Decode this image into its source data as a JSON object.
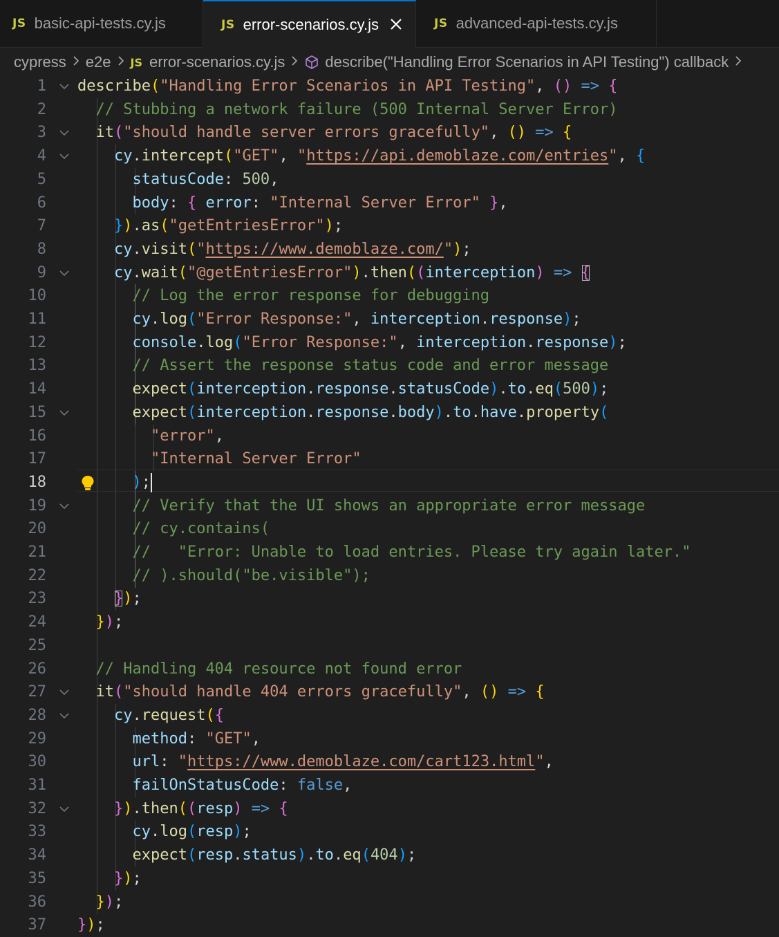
{
  "tabs": [
    {
      "label": "basic-api-tests.cy.js",
      "icon": "JS",
      "active": false
    },
    {
      "label": "error-scenarios.cy.js",
      "icon": "JS",
      "active": true
    },
    {
      "label": "advanced-api-tests.cy.js",
      "icon": "JS",
      "active": false
    }
  ],
  "breadcrumb": {
    "folder1": "cypress",
    "folder2": "e2e",
    "file_icon": "JS",
    "file": "error-scenarios.cy.js",
    "symbol": "describe(\"Handling Error Scenarios in API Testing\") callback"
  },
  "editor": {
    "active_line": 18,
    "lines": [
      {
        "n": "1"
      },
      {
        "n": "2"
      },
      {
        "n": "3"
      },
      {
        "n": "4"
      },
      {
        "n": "5"
      },
      {
        "n": "6"
      },
      {
        "n": "7"
      },
      {
        "n": "8"
      },
      {
        "n": "9"
      },
      {
        "n": "10"
      },
      {
        "n": "11"
      },
      {
        "n": "12"
      },
      {
        "n": "13"
      },
      {
        "n": "14"
      },
      {
        "n": "15"
      },
      {
        "n": "16"
      },
      {
        "n": "17"
      },
      {
        "n": "18"
      },
      {
        "n": "19"
      },
      {
        "n": "20"
      },
      {
        "n": "21"
      },
      {
        "n": "22"
      },
      {
        "n": "23"
      },
      {
        "n": "24"
      },
      {
        "n": "25"
      },
      {
        "n": "26"
      },
      {
        "n": "27"
      },
      {
        "n": "28"
      },
      {
        "n": "29"
      },
      {
        "n": "30"
      },
      {
        "n": "31"
      },
      {
        "n": "32"
      },
      {
        "n": "33"
      },
      {
        "n": "34"
      },
      {
        "n": "35"
      },
      {
        "n": "36"
      },
      {
        "n": "37"
      }
    ],
    "code": [
      [
        [
          "describe",
          "f"
        ],
        [
          "(",
          "b1"
        ],
        [
          "\"Handling Error Scenarios in API Testing\"",
          "s"
        ],
        [
          ", ",
          "p"
        ],
        [
          "()",
          "b2"
        ],
        [
          " => ",
          "k"
        ],
        [
          "{",
          "b2"
        ]
      ],
      [
        [
          "  ",
          "p"
        ],
        [
          "// Stubbing a network failure (500 Internal Server Error)",
          "c"
        ]
      ],
      [
        [
          "  ",
          "p"
        ],
        [
          "it",
          "f"
        ],
        [
          "(",
          "b2"
        ],
        [
          "\"should handle server errors gracefully\"",
          "s"
        ],
        [
          ", ",
          "p"
        ],
        [
          "()",
          "b1"
        ],
        [
          " => ",
          "k"
        ],
        [
          "{",
          "b1"
        ]
      ],
      [
        [
          "    ",
          "p"
        ],
        [
          "cy",
          "v"
        ],
        [
          ".",
          "p"
        ],
        [
          "intercept",
          "f"
        ],
        [
          "(",
          "b1"
        ],
        [
          "\"GET\"",
          "s"
        ],
        [
          ", ",
          "p"
        ],
        [
          "\"",
          "s"
        ],
        [
          "https://api.demoblaze.com/entries",
          "su"
        ],
        [
          "\"",
          "s"
        ],
        [
          ", ",
          "p"
        ],
        [
          "{",
          "b3"
        ]
      ],
      [
        [
          "      ",
          "p"
        ],
        [
          "statusCode",
          "v"
        ],
        [
          ": ",
          "p"
        ],
        [
          "500",
          "n"
        ],
        [
          ",",
          "p"
        ]
      ],
      [
        [
          "      ",
          "p"
        ],
        [
          "body",
          "v"
        ],
        [
          ": ",
          "p"
        ],
        [
          "{",
          "b2"
        ],
        [
          " ",
          "p"
        ],
        [
          "error",
          "v"
        ],
        [
          ": ",
          "p"
        ],
        [
          "\"Internal Server Error\"",
          "s"
        ],
        [
          " ",
          "p"
        ],
        [
          "}",
          "b2"
        ],
        [
          ",",
          "p"
        ]
      ],
      [
        [
          "    ",
          "p"
        ],
        [
          "}",
          "b3"
        ],
        [
          ")",
          "b1"
        ],
        [
          ".",
          "p"
        ],
        [
          "as",
          "f"
        ],
        [
          "(",
          "b1"
        ],
        [
          "\"getEntriesError\"",
          "s"
        ],
        [
          ")",
          "b1"
        ],
        [
          ";",
          "p"
        ]
      ],
      [
        [
          "    ",
          "p"
        ],
        [
          "cy",
          "v"
        ],
        [
          ".",
          "p"
        ],
        [
          "visit",
          "f"
        ],
        [
          "(",
          "b1"
        ],
        [
          "\"",
          "s"
        ],
        [
          "https://www.demoblaze.com/",
          "su"
        ],
        [
          "\"",
          "s"
        ],
        [
          ")",
          "b1"
        ],
        [
          ";",
          "p"
        ]
      ],
      [
        [
          "    ",
          "p"
        ],
        [
          "cy",
          "v"
        ],
        [
          ".",
          "p"
        ],
        [
          "wait",
          "f"
        ],
        [
          "(",
          "b1"
        ],
        [
          "\"@getEntriesError\"",
          "s"
        ],
        [
          ")",
          "b1"
        ],
        [
          ".",
          "p"
        ],
        [
          "then",
          "f"
        ],
        [
          "(",
          "b1"
        ],
        [
          "(",
          "b2"
        ],
        [
          "interception",
          "v"
        ],
        [
          ")",
          "b2"
        ],
        [
          " => ",
          "k"
        ],
        [
          "{",
          "b2m"
        ]
      ],
      [
        [
          "      ",
          "p"
        ],
        [
          "// Log the error response for debugging",
          "c"
        ]
      ],
      [
        [
          "      ",
          "p"
        ],
        [
          "cy",
          "v"
        ],
        [
          ".",
          "p"
        ],
        [
          "log",
          "f"
        ],
        [
          "(",
          "b3"
        ],
        [
          "\"Error Response:\"",
          "s"
        ],
        [
          ", ",
          "p"
        ],
        [
          "interception",
          "v"
        ],
        [
          ".",
          "p"
        ],
        [
          "response",
          "v"
        ],
        [
          ")",
          "b3"
        ],
        [
          ";",
          "p"
        ]
      ],
      [
        [
          "      ",
          "p"
        ],
        [
          "console",
          "v"
        ],
        [
          ".",
          "p"
        ],
        [
          "log",
          "f"
        ],
        [
          "(",
          "b3"
        ],
        [
          "\"Error Response:\"",
          "s"
        ],
        [
          ", ",
          "p"
        ],
        [
          "interception",
          "v"
        ],
        [
          ".",
          "p"
        ],
        [
          "response",
          "v"
        ],
        [
          ")",
          "b3"
        ],
        [
          ";",
          "p"
        ]
      ],
      [
        [
          "      ",
          "p"
        ],
        [
          "// Assert the response status code and error message",
          "c"
        ]
      ],
      [
        [
          "      ",
          "p"
        ],
        [
          "expect",
          "f"
        ],
        [
          "(",
          "b3"
        ],
        [
          "interception",
          "v"
        ],
        [
          ".",
          "p"
        ],
        [
          "response",
          "v"
        ],
        [
          ".",
          "p"
        ],
        [
          "statusCode",
          "v"
        ],
        [
          ")",
          "b3"
        ],
        [
          ".",
          "p"
        ],
        [
          "to",
          "v"
        ],
        [
          ".",
          "p"
        ],
        [
          "eq",
          "f"
        ],
        [
          "(",
          "b3"
        ],
        [
          "500",
          "n"
        ],
        [
          ")",
          "b3"
        ],
        [
          ";",
          "p"
        ]
      ],
      [
        [
          "      ",
          "p"
        ],
        [
          "expect",
          "f"
        ],
        [
          "(",
          "b3"
        ],
        [
          "interception",
          "v"
        ],
        [
          ".",
          "p"
        ],
        [
          "response",
          "v"
        ],
        [
          ".",
          "p"
        ],
        [
          "body",
          "v"
        ],
        [
          ")",
          "b3"
        ],
        [
          ".",
          "p"
        ],
        [
          "to",
          "v"
        ],
        [
          ".",
          "p"
        ],
        [
          "have",
          "v"
        ],
        [
          ".",
          "p"
        ],
        [
          "property",
          "f"
        ],
        [
          "(",
          "b3"
        ]
      ],
      [
        [
          "        ",
          "p"
        ],
        [
          "\"error\"",
          "s"
        ],
        [
          ",",
          "p"
        ]
      ],
      [
        [
          "        ",
          "p"
        ],
        [
          "\"Internal Server Error\"",
          "s"
        ]
      ],
      [
        [
          "      ",
          "p"
        ],
        [
          ")",
          "b3"
        ],
        [
          ";",
          "p"
        ]
      ],
      [
        [
          "      ",
          "p"
        ],
        [
          "// Verify that the UI shows an appropriate error message",
          "c"
        ]
      ],
      [
        [
          "      ",
          "p"
        ],
        [
          "// cy.contains(",
          "c"
        ]
      ],
      [
        [
          "      ",
          "p"
        ],
        [
          "//   \"Error: Unable to load entries. Please try again later.\"",
          "c"
        ]
      ],
      [
        [
          "      ",
          "p"
        ],
        [
          "// ).should(\"be.visible\");",
          "c"
        ]
      ],
      [
        [
          "    ",
          "p"
        ],
        [
          "}",
          "b2m"
        ],
        [
          ")",
          "b1"
        ],
        [
          ";",
          "p"
        ]
      ],
      [
        [
          "  ",
          "p"
        ],
        [
          "}",
          "b1"
        ],
        [
          ")",
          "b2"
        ],
        [
          ";",
          "p"
        ]
      ],
      [],
      [
        [
          "  ",
          "p"
        ],
        [
          "// Handling 404 resource not found error",
          "c"
        ]
      ],
      [
        [
          "  ",
          "p"
        ],
        [
          "it",
          "f"
        ],
        [
          "(",
          "b2"
        ],
        [
          "\"should handle 404 errors gracefully\"",
          "s"
        ],
        [
          ", ",
          "p"
        ],
        [
          "()",
          "b1"
        ],
        [
          " => ",
          "k"
        ],
        [
          "{",
          "b1"
        ]
      ],
      [
        [
          "    ",
          "p"
        ],
        [
          "cy",
          "v"
        ],
        [
          ".",
          "p"
        ],
        [
          "request",
          "f"
        ],
        [
          "(",
          "b1"
        ],
        [
          "{",
          "b2"
        ]
      ],
      [
        [
          "      ",
          "p"
        ],
        [
          "method",
          "v"
        ],
        [
          ": ",
          "p"
        ],
        [
          "\"GET\"",
          "s"
        ],
        [
          ",",
          "p"
        ]
      ],
      [
        [
          "      ",
          "p"
        ],
        [
          "url",
          "v"
        ],
        [
          ": ",
          "p"
        ],
        [
          "\"",
          "s"
        ],
        [
          "https://www.demoblaze.com/cart123.html",
          "su"
        ],
        [
          "\"",
          "s"
        ],
        [
          ",",
          "p"
        ]
      ],
      [
        [
          "      ",
          "p"
        ],
        [
          "failOnStatusCode",
          "v"
        ],
        [
          ": ",
          "p"
        ],
        [
          "false",
          "k"
        ],
        [
          ",",
          "p"
        ]
      ],
      [
        [
          "    ",
          "p"
        ],
        [
          "}",
          "b2"
        ],
        [
          ")",
          "b1"
        ],
        [
          ".",
          "p"
        ],
        [
          "then",
          "f"
        ],
        [
          "(",
          "b1"
        ],
        [
          "(",
          "b2"
        ],
        [
          "resp",
          "v"
        ],
        [
          ")",
          "b2"
        ],
        [
          " => ",
          "k"
        ],
        [
          "{",
          "b2"
        ]
      ],
      [
        [
          "      ",
          "p"
        ],
        [
          "cy",
          "v"
        ],
        [
          ".",
          "p"
        ],
        [
          "log",
          "f"
        ],
        [
          "(",
          "b3"
        ],
        [
          "resp",
          "v"
        ],
        [
          ")",
          "b3"
        ],
        [
          ";",
          "p"
        ]
      ],
      [
        [
          "      ",
          "p"
        ],
        [
          "expect",
          "f"
        ],
        [
          "(",
          "b3"
        ],
        [
          "resp",
          "v"
        ],
        [
          ".",
          "p"
        ],
        [
          "status",
          "v"
        ],
        [
          ")",
          "b3"
        ],
        [
          ".",
          "p"
        ],
        [
          "to",
          "v"
        ],
        [
          ".",
          "p"
        ],
        [
          "eq",
          "f"
        ],
        [
          "(",
          "b3"
        ],
        [
          "404",
          "n"
        ],
        [
          ")",
          "b3"
        ],
        [
          ";",
          "p"
        ]
      ],
      [
        [
          "    ",
          "p"
        ],
        [
          "}",
          "b2"
        ],
        [
          ")",
          "b1"
        ],
        [
          ";",
          "p"
        ]
      ],
      [
        [
          "  ",
          "p"
        ],
        [
          "}",
          "b1"
        ],
        [
          ")",
          "b2"
        ],
        [
          ";",
          "p"
        ]
      ],
      [
        [
          "}",
          "b2"
        ],
        [
          ")",
          "b1"
        ],
        [
          ";",
          "p"
        ]
      ]
    ]
  },
  "colors": {
    "background": "#1f1f1f",
    "tab_accent": "#0078d4",
    "js_icon": "#cbcb41",
    "lightbulb": "#ffcc00"
  },
  "icons": {
    "fold": "chevron-down-icon",
    "symbol": "cube-icon",
    "close": "close-icon",
    "code_action": "lightbulb-icon"
  }
}
